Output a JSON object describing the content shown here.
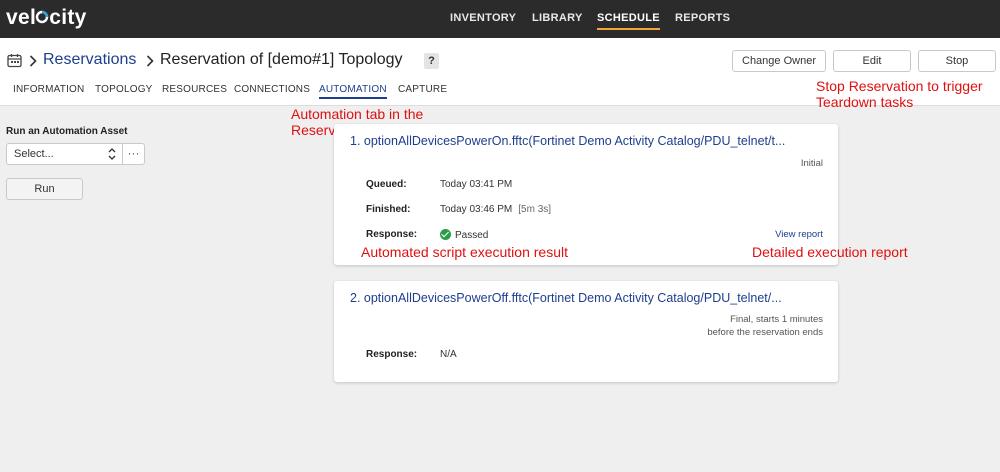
{
  "app": {
    "logo_text": "velocity",
    "logo_prefix": "vel",
    "logo_o": "o",
    "logo_suffix": "city"
  },
  "nav": {
    "items": [
      "INVENTORY",
      "LIBRARY",
      "SCHEDULE",
      "REPORTS"
    ],
    "active": "SCHEDULE",
    "accent": "#f0a733"
  },
  "breadcrumb": {
    "root": "Reservations",
    "title": "Reservation of [demo#1] Topology",
    "help": "?"
  },
  "header_buttons": {
    "change_owner": "Change Owner",
    "edit": "Edit",
    "stop": "Stop"
  },
  "tabs": [
    "INFORMATION",
    "TOPOLOGY",
    "RESOURCES",
    "CONNECTIONS",
    "AUTOMATION",
    "CAPTURE"
  ],
  "active_tab": "AUTOMATION",
  "left_panel": {
    "label": "Run an Automation Asset",
    "select_value": "Select...",
    "more": "···",
    "run": "Run"
  },
  "executions": [
    {
      "title": "1. optionAllDevicesPowerOn.fftc(Fortinet Demo Activity Catalog/PDU_telnet/t...",
      "state": "Initial",
      "queued_label": "Queued:",
      "queued": "Today 03:41 PM",
      "finished_label": "Finished:",
      "finished": "Today 03:46 PM",
      "duration": "[5m 3s]",
      "response_label": "Response:",
      "response": "Passed",
      "response_color": "#2b9e48",
      "view_report": "View report"
    },
    {
      "title": "2. optionAllDevicesPowerOff.fftc(Fortinet Demo Activity Catalog/PDU_telnet/...",
      "state_line1": "Final, starts 1 minutes",
      "state_line2": "before the reservation ends",
      "response_label": "Response:",
      "response": "N/A"
    }
  ],
  "annotations": {
    "stop_line1": "Stop Reservation to trigger",
    "stop_line2": "Teardown tasks",
    "tab_line1": "Automation tab in the",
    "tab_line2": "Reservation page",
    "result": "Automated script execution result",
    "report": "Detailed execution report",
    "color": "#e01010"
  }
}
